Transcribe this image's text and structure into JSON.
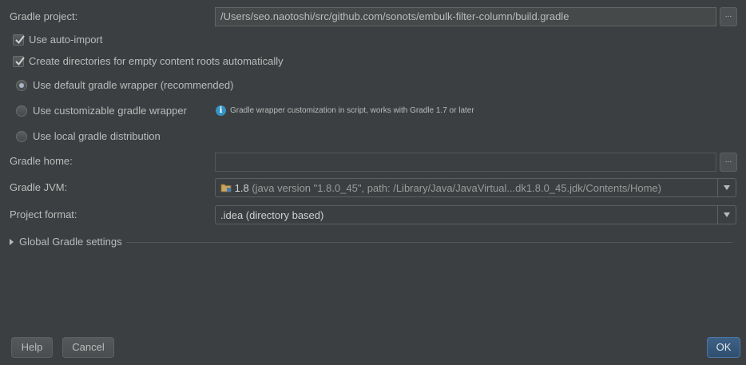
{
  "form": {
    "gradle_project_label": "Gradle project:",
    "gradle_project_value": "/Users/seo.naotoshi/src/github.com/sonots/embulk-filter-column/build.gradle",
    "browse_label": "...",
    "auto_import_label": "Use auto-import",
    "auto_import_checked": true,
    "create_dirs_label": "Create directories for empty content roots automatically",
    "create_dirs_checked": true,
    "wrapper_options": [
      {
        "label": "Use default gradle wrapper (recommended)",
        "selected": true
      },
      {
        "label": "Use customizable gradle wrapper",
        "selected": false
      },
      {
        "label": "Use local gradle distribution",
        "selected": false
      }
    ],
    "wrapper_hint_icon": "info-icon",
    "wrapper_hint_icon_glyph": "i",
    "wrapper_hint": "Gradle wrapper customization in script, works with Gradle 1.7 or later",
    "gradle_home_label": "Gradle home:",
    "gradle_home_value": "",
    "gradle_jvm_label": "Gradle JVM:",
    "gradle_jvm_icon": "folder-icon",
    "gradle_jvm_version": "1.8",
    "gradle_jvm_detail": "(java version \"1.8.0_45\", path: /Library/Java/JavaVirtual...dk1.8.0_45.jdk/Contents/Home)",
    "project_format_label": "Project format:",
    "project_format_value": ".idea (directory based)",
    "global_settings_label": "Global Gradle settings"
  },
  "buttons": {
    "help": "Help",
    "cancel": "Cancel",
    "ok": "OK"
  },
  "colors": {
    "background": "#3c3f41",
    "text": "#bbbbbb",
    "accent": "#4a76a8"
  }
}
